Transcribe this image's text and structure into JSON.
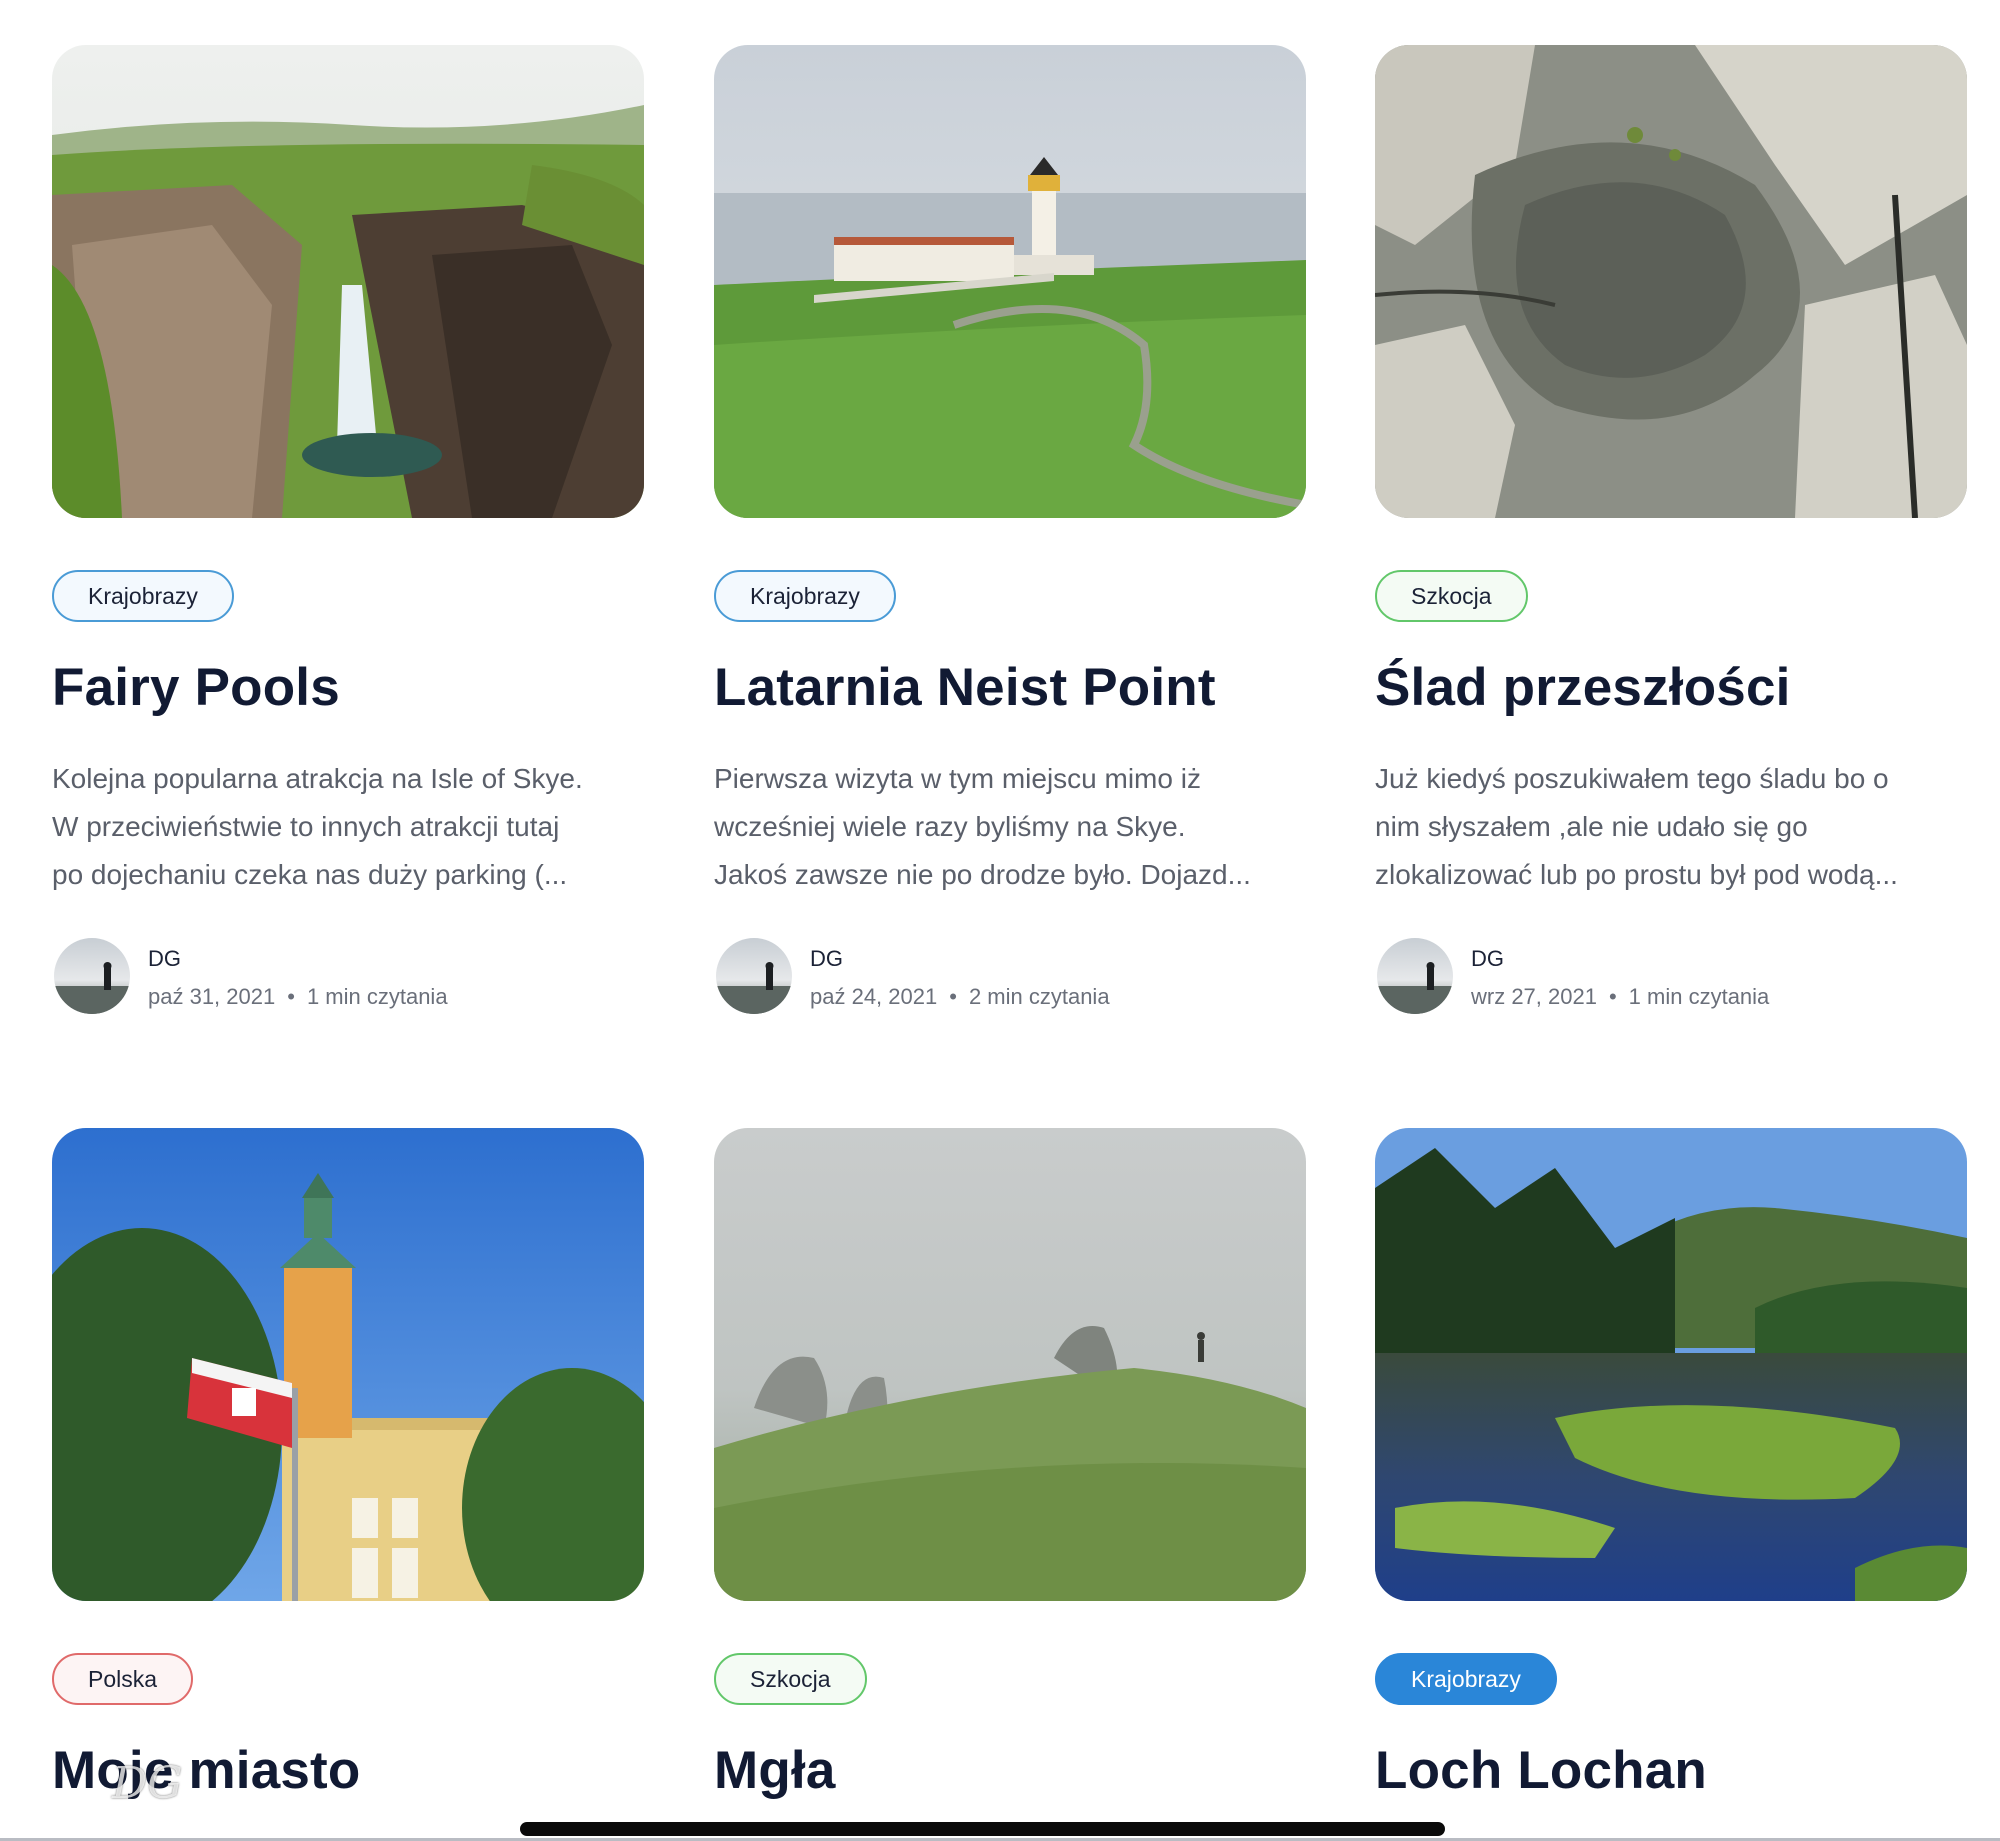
{
  "posts": [
    {
      "image": "waterfall-gorge-photo",
      "tag": "Krajobrazy",
      "title": "Fairy Pools",
      "excerpt": [
        "Kolejna popularna atrakcja na Isle of Skye.",
        "W przeciwieństwie to innych atrakcji tutaj",
        "po dojechaniu czeka nas duży parking (..."
      ],
      "author": "DG",
      "date": "paź 31, 2021",
      "read_time": "1 min czytania"
    },
    {
      "image": "lighthouse-coast-photo",
      "tag": "Krajobrazy",
      "title": "Latarnia Neist Point",
      "excerpt": [
        "Pierwsza wizyta w tym miejscu mimo iż",
        "wcześniej wiele razy byliśmy na Skye.",
        "Jakoś zawsze nie po drodze było. Dojazd..."
      ],
      "author": "DG",
      "date": "paź 24, 2021",
      "read_time": "2 min czytania"
    },
    {
      "image": "rock-footprint-photo",
      "tag": "Szkocja",
      "title": "Ślad przeszłości",
      "excerpt": [
        "Już kiedyś poszukiwałem tego śladu bo o",
        "nim słyszałem ,ale nie udało się go",
        "zlokalizować lub po prostu był pod wodą..."
      ],
      "author": "DG",
      "date": "wrz 27, 2021",
      "read_time": "1 min czytania"
    },
    {
      "image": "town-hall-flag-photo",
      "tag": "Polska",
      "title": "Moje miasto",
      "excerpt": [],
      "author": "",
      "date": "",
      "read_time": ""
    },
    {
      "image": "foggy-hill-photo",
      "tag": "Szkocja",
      "title": "Mgła",
      "excerpt": [],
      "author": "",
      "date": "",
      "read_time": ""
    },
    {
      "image": "loch-forest-photo",
      "tag": "Krajobrazy",
      "title": "Loch Lochan",
      "excerpt": [],
      "author": "",
      "date": "",
      "read_time": ""
    }
  ],
  "meta_separator": "•",
  "watermark": "DG",
  "colors": {
    "title": "#111a33",
    "tag_blue": "#4a9bd6",
    "tag_green": "#62c76a",
    "tag_red": "#e06a6a",
    "tag_blue_filled": "#2a86d8"
  }
}
